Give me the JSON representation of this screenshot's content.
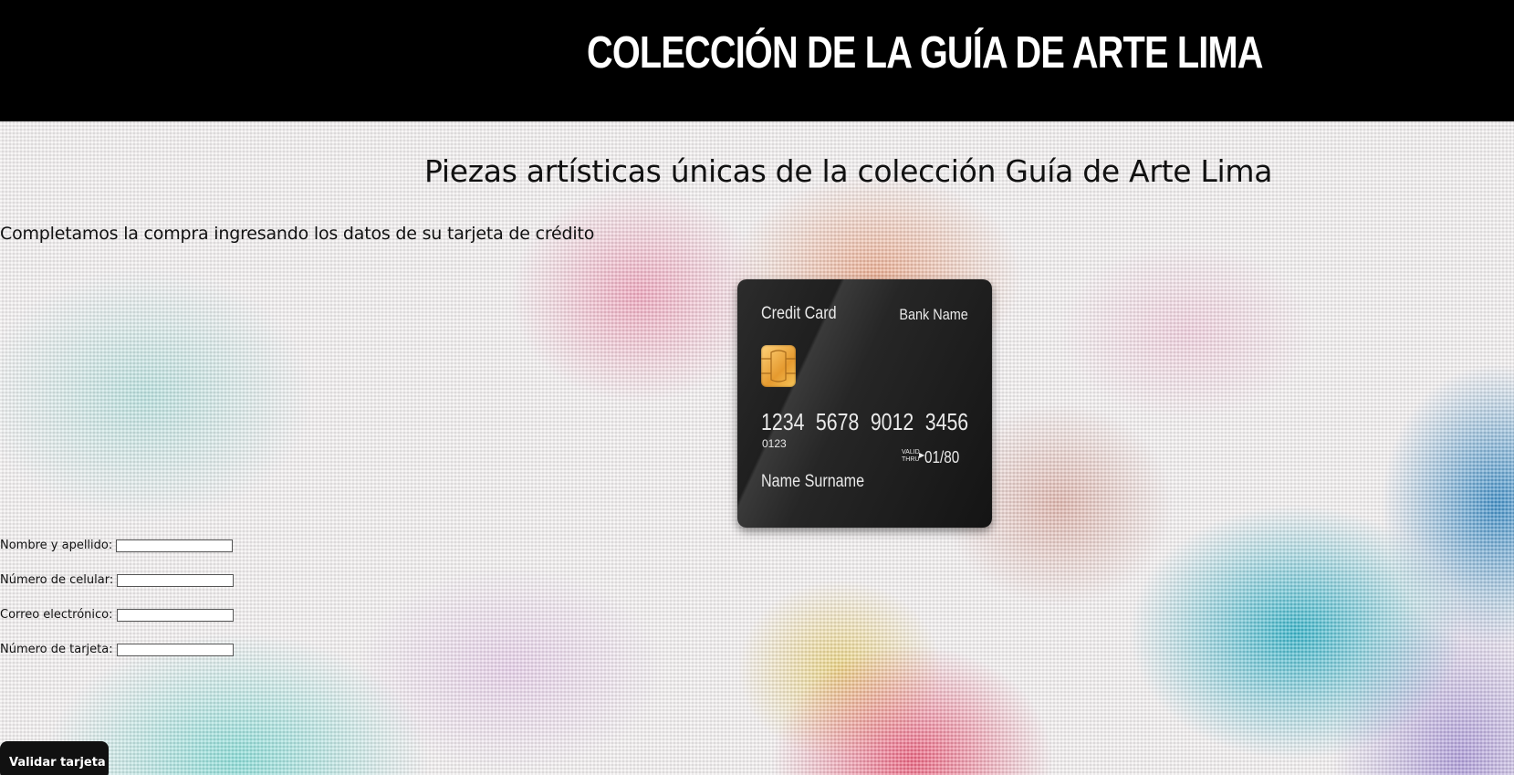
{
  "header": {
    "title": "COLECCIÓN DE LA GUÍA DE ARTE LIMA"
  },
  "main": {
    "subtitle": "Piezas artísticas únicas de la colección Guía de Arte Lima",
    "instruction": "Completamos la compra ingresando los datos de su tarjeta de crédito"
  },
  "card": {
    "label": "Credit Card",
    "bank": "Bank Name",
    "number": "1234 5678 9012 3456",
    "small_code": "0123",
    "valid_thru": "VALID THRU",
    "expiry": "01/80",
    "holder": "Name Surname"
  },
  "form": {
    "fields": [
      {
        "label": "Nombre y apellido:",
        "value": ""
      },
      {
        "label": "Número de celular:",
        "value": ""
      },
      {
        "label": "Correo electrónico:",
        "value": ""
      },
      {
        "label": "Número de tarjeta:",
        "value": ""
      }
    ],
    "submit_label": "Validar tarjeta"
  }
}
